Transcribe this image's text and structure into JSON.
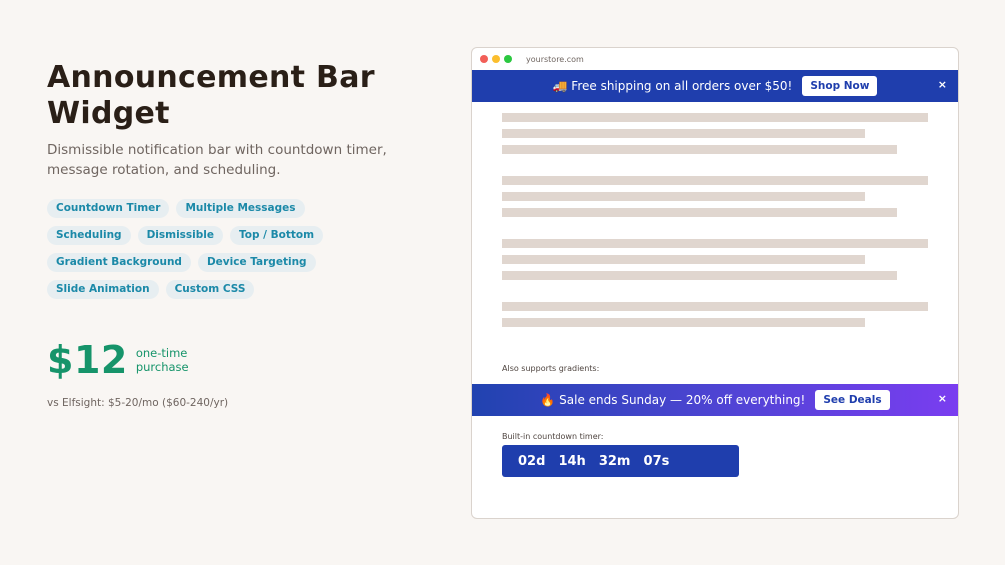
{
  "hero": {
    "title": "Announcement Bar Widget",
    "subtitle": "Dismissible notification bar with countdown timer, message rotation, and scheduling."
  },
  "features": [
    "Countdown Timer",
    "Multiple Messages",
    "Scheduling",
    "Dismissible",
    "Top / Bottom",
    "Gradient Background",
    "Device Targeting",
    "Slide Animation",
    "Custom CSS"
  ],
  "pricing": {
    "price": "$12",
    "note_line1": "one-time",
    "note_line2": "purchase",
    "compare": "vs Elfsight: $5-20/mo ($60-240/yr)"
  },
  "browser": {
    "url": "yourstore.com",
    "bar1": {
      "icon": "truck-icon",
      "message": "🚚 Free shipping on all orders over $50!",
      "button": "Shop Now",
      "close": "×",
      "color": "#1f3ead"
    },
    "gradient_label": "Also supports gradients:",
    "bar2": {
      "icon": "fire-icon",
      "message": "🔥 Sale ends Sunday — 20% off everything!",
      "button": "See Deals",
      "close": "×",
      "gradient_from": "#2143b0",
      "gradient_to": "#7a3df0"
    },
    "timer": {
      "label": "Built-in countdown timer:",
      "value": "02d  14h  32m  07s"
    }
  },
  "colors": {
    "accent": "#1f3ead",
    "price": "#16946a",
    "tag_text": "#1b89a8",
    "background": "#f9f6f3"
  }
}
